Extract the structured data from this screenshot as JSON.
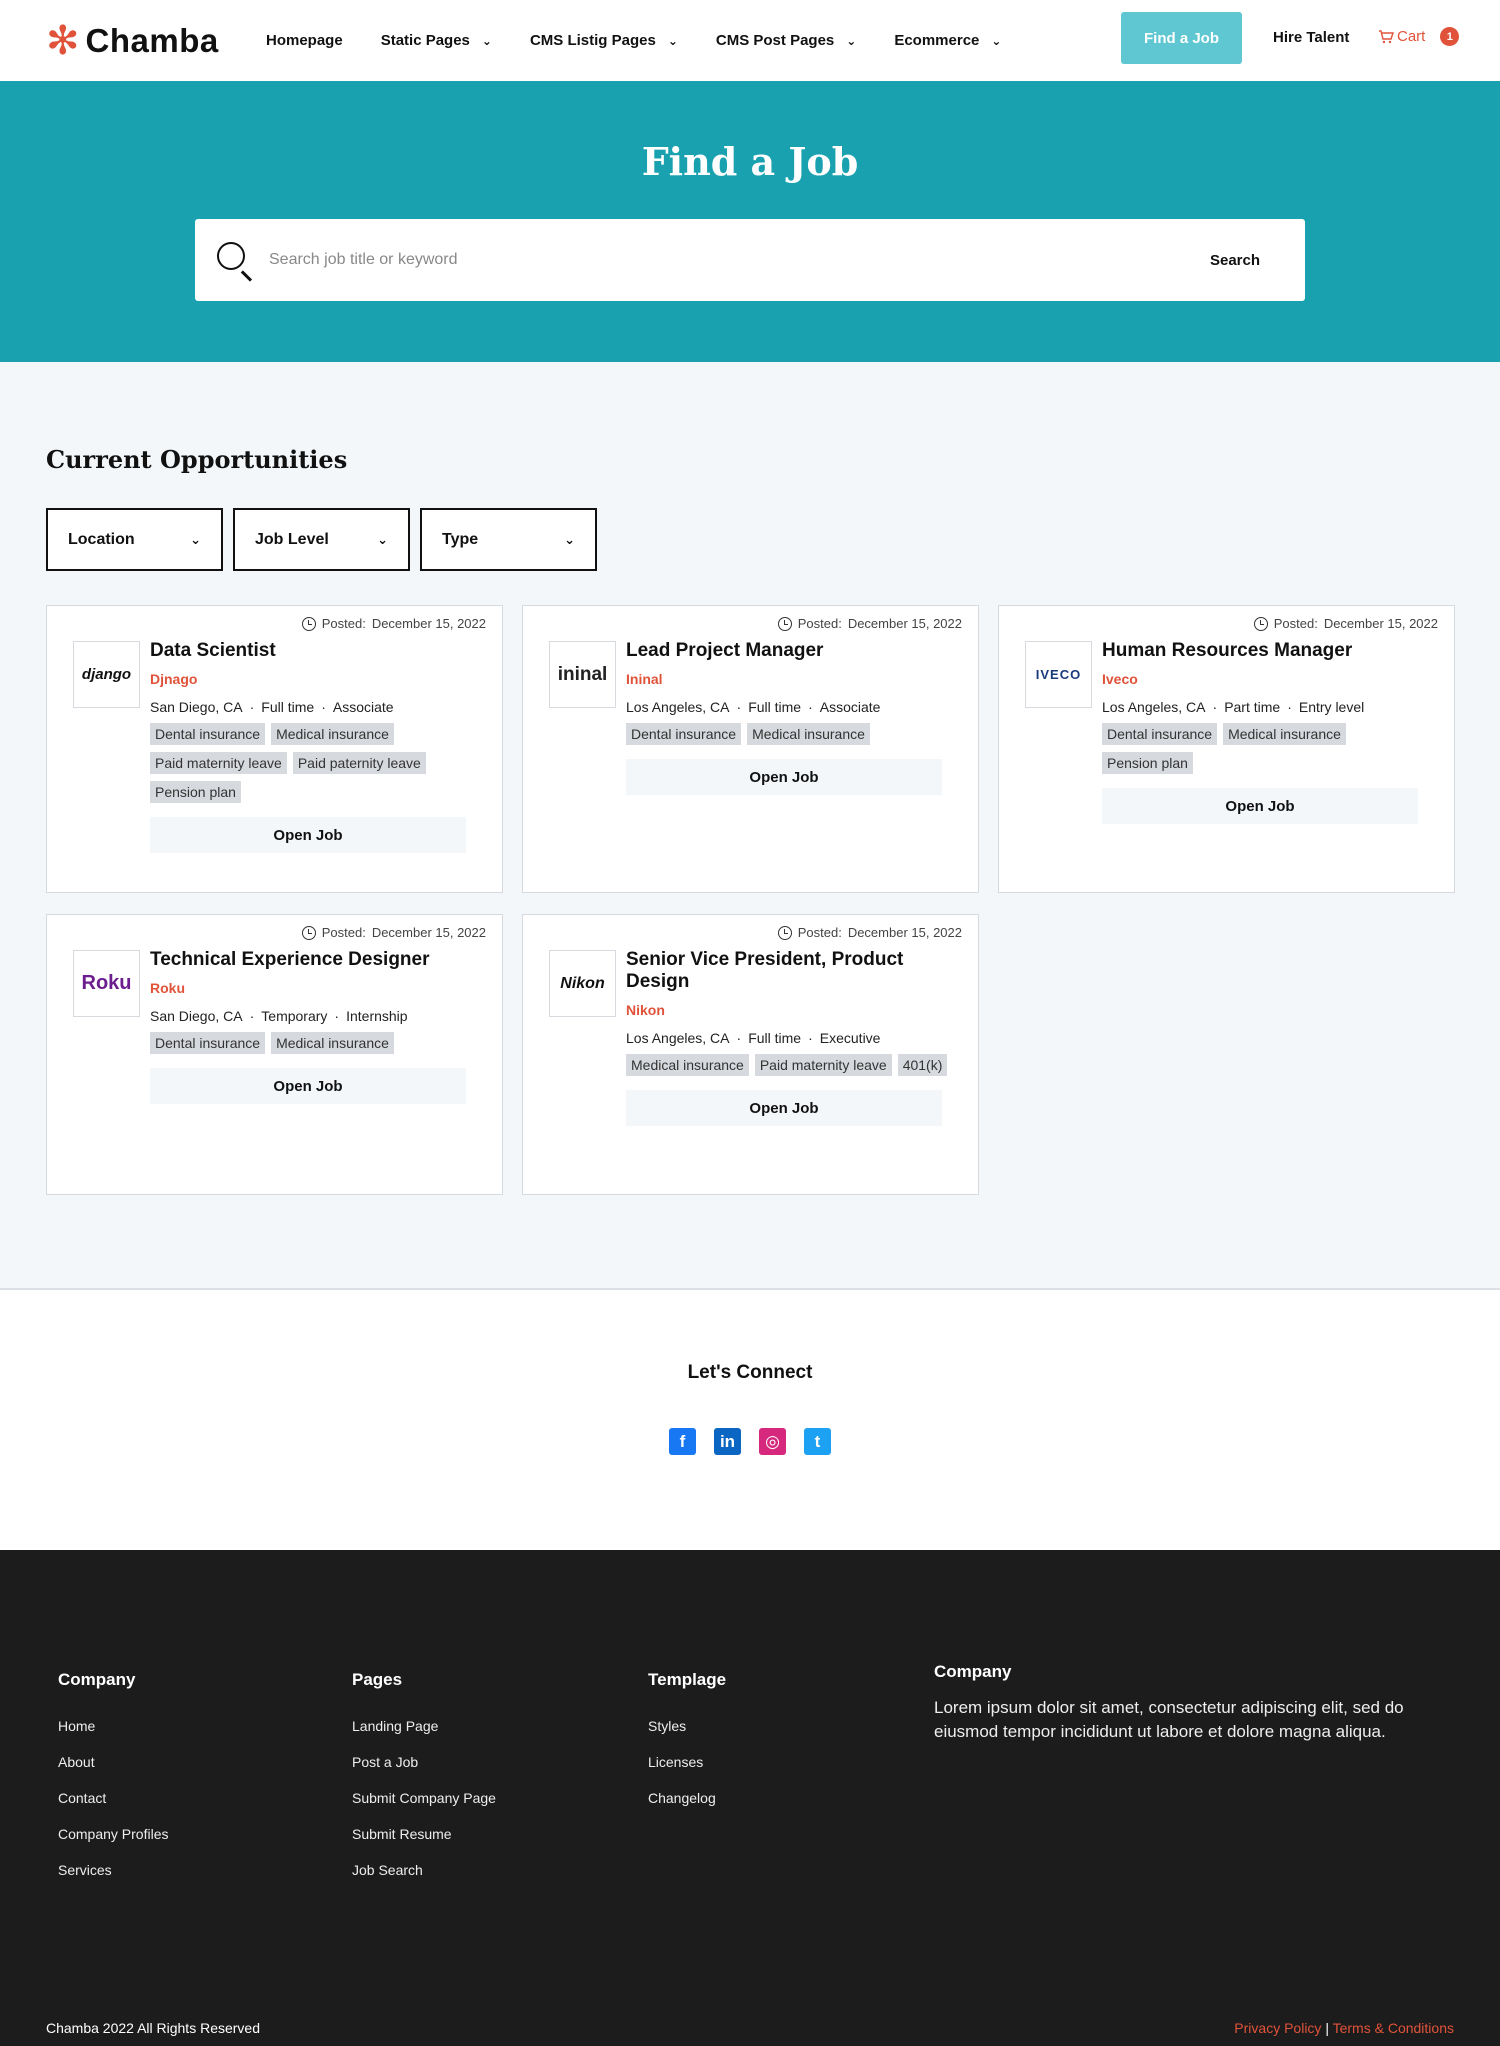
{
  "nav": {
    "logo": "Chamba",
    "items": [
      {
        "label": "Homepage",
        "dropdown": false
      },
      {
        "label": "Static Pages",
        "dropdown": true
      },
      {
        "label": "CMS Listig Pages",
        "dropdown": true
      },
      {
        "label": "CMS Post Pages",
        "dropdown": true
      },
      {
        "label": "Ecommerce",
        "dropdown": true
      }
    ],
    "find_job": "Find a Job",
    "hire_talent": "Hire Talent",
    "cart_label": "Cart",
    "cart_count": "1"
  },
  "hero": {
    "title": "Find a Job",
    "search_placeholder": "Search job title or keyword",
    "search_button": "Search"
  },
  "main": {
    "title": "Current Opportunities",
    "filters": [
      "Location",
      "Job Level",
      "Type"
    ],
    "posted_label": "Posted:",
    "open_job": "Open Job",
    "jobs": [
      {
        "title": "Data Scientist",
        "company": "Djnago",
        "logo": "django",
        "posted": "December 15, 2022",
        "location": "San Diego, CA",
        "time": "Full time",
        "level": "Associate",
        "tags": [
          "Dental insurance",
          "Medical insurance",
          "Paid maternity leave",
          "Paid paternity leave",
          "Pension plan"
        ]
      },
      {
        "title": "Lead Project Manager",
        "company": "Ininal",
        "logo": "ininal",
        "posted": "December 15, 2022",
        "location": "Los Angeles, CA",
        "time": "Full time",
        "level": "Associate",
        "tags": [
          "Dental insurance",
          "Medical insurance"
        ]
      },
      {
        "title": "Human Resources Manager",
        "company": "Iveco",
        "logo": "IVECO",
        "posted": "December 15, 2022",
        "location": "Los Angeles, CA",
        "time": "Part time",
        "level": "Entry level",
        "tags": [
          "Dental insurance",
          "Medical insurance",
          "Pension plan"
        ]
      },
      {
        "title": "Technical Experience Designer",
        "company": "Roku",
        "logo": "Roku",
        "posted": "December 15, 2022",
        "location": "San Diego, CA",
        "time": "Temporary",
        "level": "Internship",
        "tags": [
          "Dental insurance",
          "Medical insurance"
        ]
      },
      {
        "title": "Senior Vice President, Product Design",
        "company": "Nikon",
        "logo": "Nikon",
        "posted": "December 15, 2022",
        "location": "Los Angeles, CA",
        "time": "Full time",
        "level": "Executive",
        "tags": [
          "Medical insurance",
          "Paid maternity leave",
          "401(k)"
        ]
      }
    ]
  },
  "connect": {
    "title": "Let's Connect",
    "socials": [
      {
        "icon": "facebook-icon",
        "glyph": "f",
        "color": "#1877f2"
      },
      {
        "icon": "linkedin-icon",
        "glyph": "in",
        "color": "#0a66c2"
      },
      {
        "icon": "instagram-icon",
        "glyph": "◎",
        "color": "#d6297d"
      },
      {
        "icon": "twitter-icon",
        "glyph": "t",
        "color": "#1da1f2"
      }
    ]
  },
  "footer": {
    "columns": [
      {
        "title": "Company",
        "links": [
          "Home",
          "About",
          "Contact",
          "Company Profiles",
          "Services"
        ]
      },
      {
        "title": "Pages",
        "links": [
          "Landing Page",
          "Post a Job",
          "Submit Company Page",
          "Submit Resume",
          "Job Search"
        ]
      },
      {
        "title": "Templage",
        "links": [
          "Styles",
          "Licenses",
          "Changelog"
        ]
      }
    ],
    "about_title": "Company",
    "about_text": "Lorem ipsum dolor sit amet, consectetur adipiscing elit, sed do eiusmod tempor incididunt ut labore et dolore magna aliqua.",
    "copyright": "Chamba 2022 All Rights Reserved",
    "privacy": "Privacy Policy",
    "separator": "|",
    "terms": "Terms & Conditions"
  },
  "colors": {
    "accent": "#e0533a",
    "hero": "#1aa1b0",
    "button": "#5fc7d2"
  }
}
